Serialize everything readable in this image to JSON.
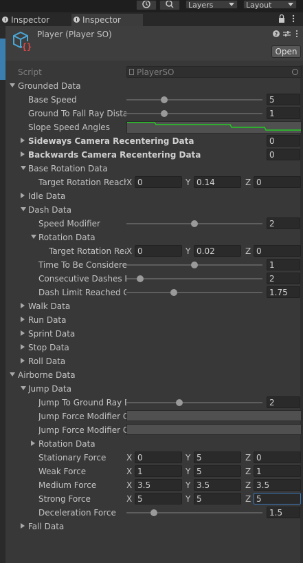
{
  "toolbar": {
    "layers_label": "Layers",
    "layout_label": "Layout",
    "history_icon": "history-icon",
    "search_icon": "search-icon"
  },
  "tabs": [
    {
      "label": "Inspector",
      "icon": "info-icon"
    },
    {
      "label": "Inspector",
      "icon": "info-icon"
    }
  ],
  "header": {
    "title": "Player (Player SO)",
    "open_label": "Open",
    "asset_icon": "scriptable-object-icon"
  },
  "colors": {
    "accent": "#3a79bb",
    "curve": "#22cc22",
    "background": "#383838"
  },
  "rows": [
    {
      "type": "script",
      "label": "Script",
      "value": "PlayerSO",
      "indent": 0
    },
    {
      "type": "foldout",
      "label": "Grounded Data",
      "open": true,
      "indent": 0
    },
    {
      "type": "slider",
      "label": "Base Speed",
      "indent": 1,
      "fill": 0.28,
      "value": "5"
    },
    {
      "type": "slider",
      "label": "Ground To Fall Ray Dista",
      "indent": 1,
      "fill": 0.28,
      "value": "1"
    },
    {
      "type": "curve",
      "label": "Slope Speed Angles",
      "indent": 1
    },
    {
      "type": "foldout-int",
      "label": "Sideways Camera Recentering Data",
      "open": false,
      "bold": true,
      "indent": 1,
      "value": "0"
    },
    {
      "type": "foldout-int",
      "label": "Backwards Camera Recentering Data",
      "open": false,
      "bold": true,
      "indent": 1,
      "value": "0"
    },
    {
      "type": "foldout",
      "label": "Base Rotation Data",
      "open": true,
      "indent": 1
    },
    {
      "type": "vector",
      "label": "Target Rotation Reach",
      "indent": 2,
      "x": "0",
      "y": "0.14",
      "z": "0"
    },
    {
      "type": "foldout",
      "label": "Idle Data",
      "open": false,
      "indent": 1
    },
    {
      "type": "foldout",
      "label": "Dash Data",
      "open": true,
      "indent": 1
    },
    {
      "type": "slider",
      "label": "Speed Modifier",
      "indent": 2,
      "fill": 0.5,
      "value": "2"
    },
    {
      "type": "foldout",
      "label": "Rotation Data",
      "open": true,
      "indent": 2
    },
    {
      "type": "vector",
      "label": "Target Rotation Rea",
      "indent": 3,
      "x": "0",
      "y": "0.02",
      "z": "0"
    },
    {
      "type": "slider",
      "label": "Time To Be Considere",
      "indent": 2,
      "fill": 0.5,
      "value": "1"
    },
    {
      "type": "slider",
      "label": "Consecutive Dashes L",
      "indent": 2,
      "fill": 0.1,
      "value": "2"
    },
    {
      "type": "slider",
      "label": "Dash Limit Reached C",
      "indent": 2,
      "fill": 0.35,
      "value": "1.75"
    },
    {
      "type": "foldout",
      "label": "Walk Data",
      "open": false,
      "indent": 1
    },
    {
      "type": "foldout",
      "label": "Run Data",
      "open": false,
      "indent": 1
    },
    {
      "type": "foldout",
      "label": "Sprint Data",
      "open": false,
      "indent": 1
    },
    {
      "type": "foldout",
      "label": "Stop Data",
      "open": false,
      "indent": 1
    },
    {
      "type": "foldout",
      "label": "Roll Data",
      "open": false,
      "indent": 1
    },
    {
      "type": "foldout",
      "label": "Airborne Data",
      "open": true,
      "indent": 0
    },
    {
      "type": "foldout",
      "label": "Jump Data",
      "open": true,
      "indent": 1
    },
    {
      "type": "slider",
      "label": "Jump To Ground Ray D",
      "indent": 2,
      "fill": 0.39,
      "value": "2"
    },
    {
      "type": "curve-empty",
      "label": "Jump Force Modifier C",
      "indent": 2
    },
    {
      "type": "curve-empty",
      "label": "Jump Force Modifier C",
      "indent": 2
    },
    {
      "type": "foldout",
      "label": "Rotation Data",
      "open": false,
      "indent": 2
    },
    {
      "type": "vector",
      "label": "Stationary Force",
      "indent": 2,
      "x": "0",
      "y": "5",
      "z": "0"
    },
    {
      "type": "vector",
      "label": "Weak Force",
      "indent": 2,
      "x": "1",
      "y": "5",
      "z": "1"
    },
    {
      "type": "vector",
      "label": "Medium Force",
      "indent": 2,
      "x": "3.5",
      "y": "3.5",
      "z": "3.5"
    },
    {
      "type": "vector",
      "label": "Strong Force",
      "indent": 2,
      "x": "5",
      "y": "5",
      "z": "5",
      "focus": true
    },
    {
      "type": "slider",
      "label": "Deceleration Force",
      "indent": 2,
      "fill": 0.2,
      "value": "1.5"
    },
    {
      "type": "foldout",
      "label": "Fall Data",
      "open": false,
      "indent": 1
    }
  ]
}
